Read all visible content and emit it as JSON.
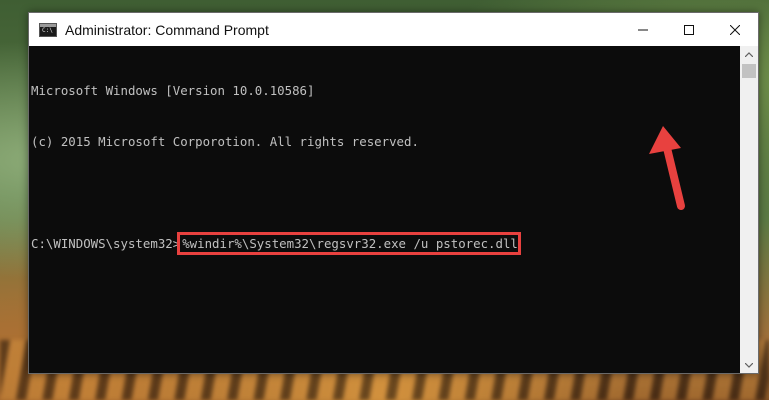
{
  "window": {
    "title": "Administrator: Command Prompt",
    "icon_text": "C:\\"
  },
  "controls": {
    "minimize": "minimize-icon",
    "maximize": "maximize-icon",
    "close": "close-icon"
  },
  "console": {
    "lines": [
      "Microsoft Windows [Version 10.0.10586]",
      "(c) 2015 Microsoft Corporotion. All rights reserved.",
      ""
    ],
    "prompt": "C:\\WINDOWS\\system32>",
    "command": "%windir%\\System32\\regsvr32.exe /u pstorec.dll"
  },
  "colors": {
    "highlight": "#e8413f",
    "arrow": "#e8413f",
    "console_bg": "#0c0c0c",
    "console_text": "#c0c0c0"
  }
}
